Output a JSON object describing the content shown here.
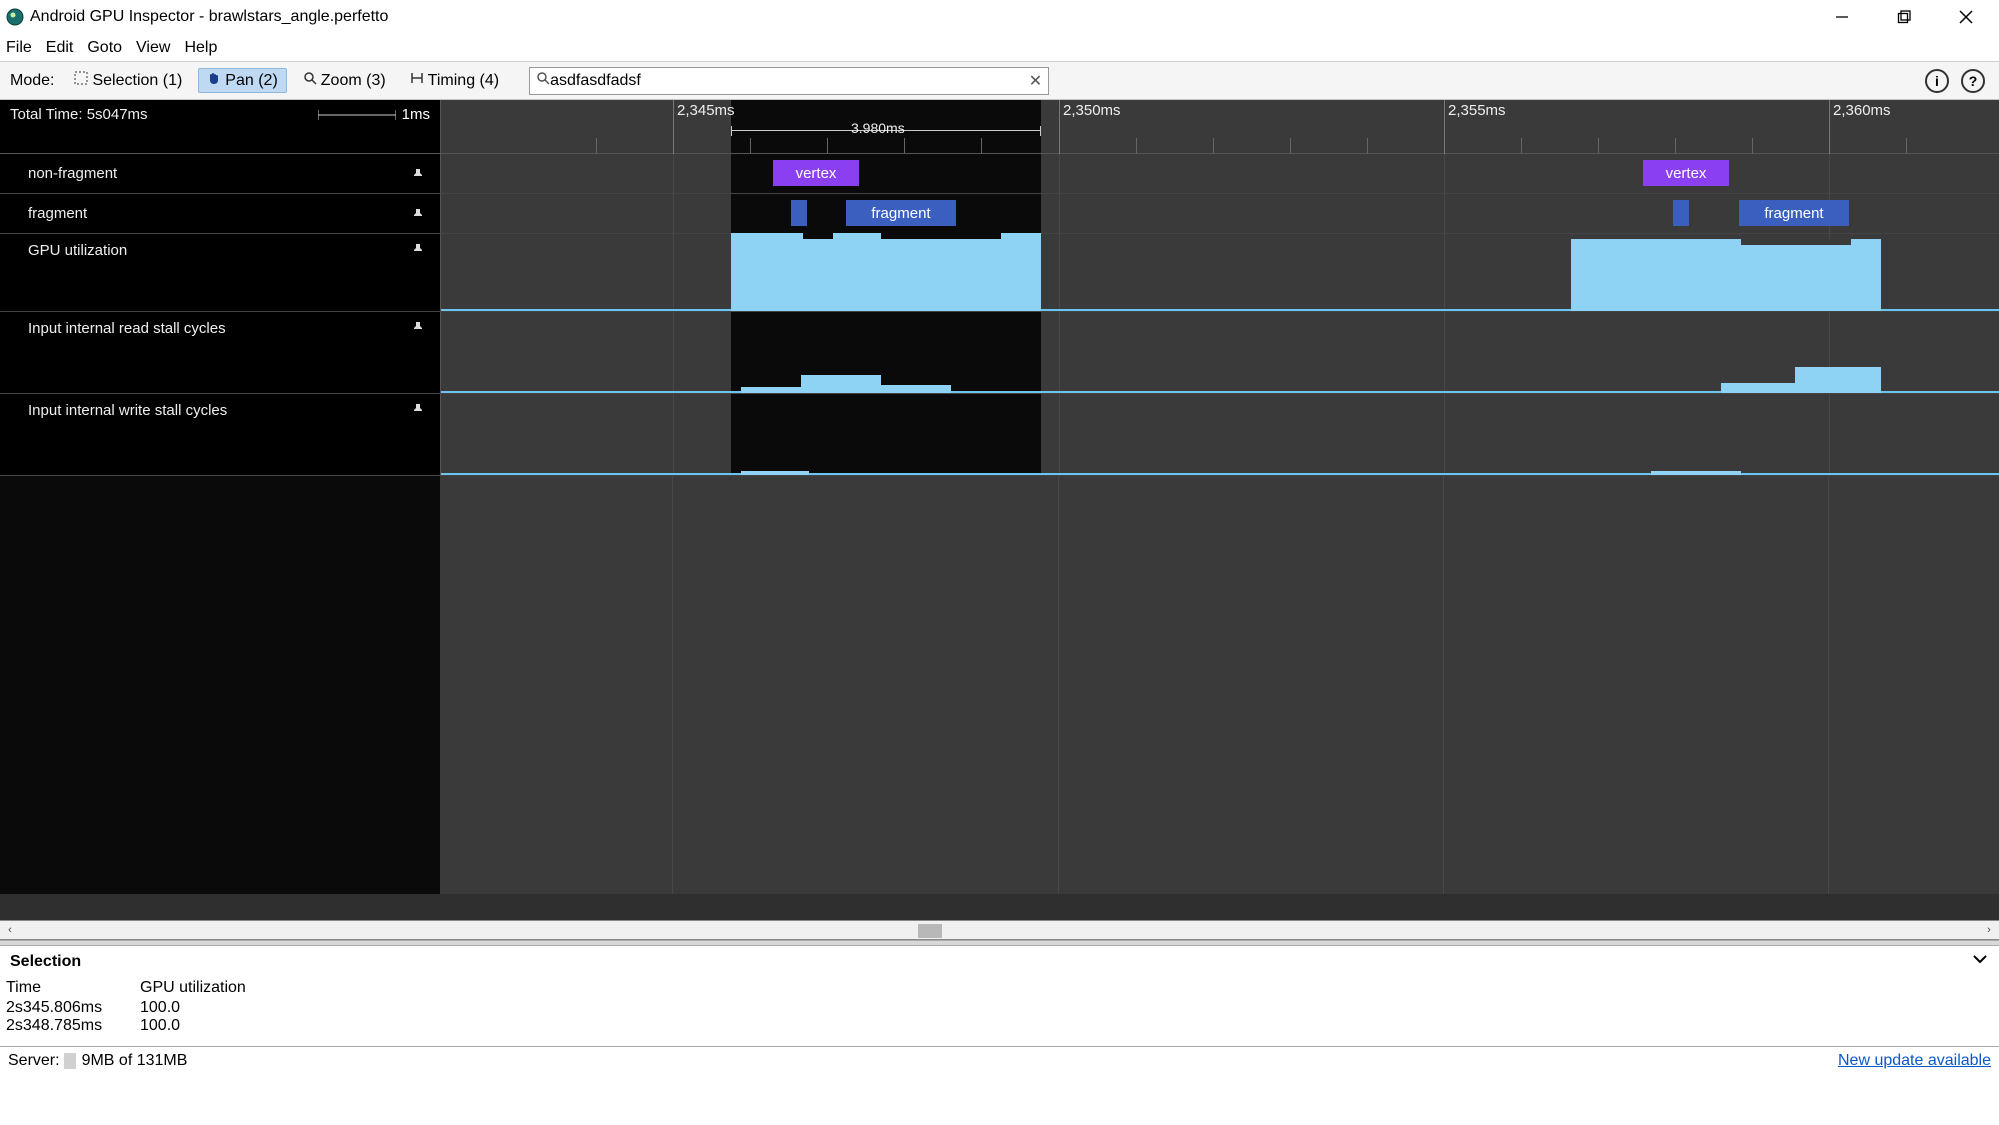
{
  "window": {
    "title": "Android GPU Inspector - brawlstars_angle.perfetto"
  },
  "menu": {
    "file": "File",
    "edit": "Edit",
    "goto": "Goto",
    "view": "View",
    "help": "Help"
  },
  "toolbar": {
    "mode_label": "Mode:",
    "selection": "Selection (1)",
    "pan": "Pan (2)",
    "zoom": "Zoom (3)",
    "timing": "Timing (4)",
    "search_value": "asdfasdfadsf"
  },
  "timeline": {
    "total_time": "Total Time: 5s047ms",
    "scale": "1ms",
    "span_duration": "3.980ms",
    "ticks": [
      "2,345ms",
      "2,350ms",
      "2,355ms",
      "2,360ms"
    ],
    "tracks": {
      "nonfragment": {
        "label": "non-fragment",
        "chip": "vertex"
      },
      "fragment": {
        "label": "fragment",
        "chip": "fragment"
      },
      "gpu_util": {
        "label": "GPU utilization"
      },
      "read_stall": {
        "label": "Input internal read stall cycles"
      },
      "write_stall": {
        "label": "Input internal write stall cycles"
      }
    }
  },
  "selection": {
    "title": "Selection",
    "col_time": "Time",
    "col_gpu": "GPU utilization",
    "rows": [
      {
        "time": "2s345.806ms",
        "gpu": "100.0"
      },
      {
        "time": "2s348.785ms",
        "gpu": "100.0"
      }
    ]
  },
  "status": {
    "server_label": "Server:",
    "server_mem": "9MB of 131MB",
    "update": "New update available"
  },
  "chart_data": {
    "type": "bar",
    "time_axis_ms": {
      "visible_start": 2342,
      "visible_end": 2363,
      "ticks_ms": [
        2345,
        2350,
        2355,
        2360
      ]
    },
    "selection_ms": {
      "start": 2345.3,
      "end": 2349.3,
      "duration_ms": 3.98
    },
    "tracks": [
      {
        "name": "non-fragment",
        "events": [
          {
            "label": "vertex",
            "start_ms": 2345.8,
            "end_ms": 2346.7
          },
          {
            "label": "vertex",
            "start_ms": 2357.0,
            "end_ms": 2358.0
          }
        ]
      },
      {
        "name": "fragment",
        "events": [
          {
            "label": "",
            "start_ms": 2345.9,
            "end_ms": 2346.1
          },
          {
            "label": "fragment",
            "start_ms": 2346.6,
            "end_ms": 2347.9
          },
          {
            "label": "",
            "start_ms": 2357.1,
            "end_ms": 2357.3
          },
          {
            "label": "fragment",
            "start_ms": 2357.9,
            "end_ms": 2359.2
          }
        ]
      },
      {
        "name": "GPU utilization",
        "unit": "percent",
        "samples": [
          {
            "start_ms": 2345.3,
            "end_ms": 2349.3,
            "value": 100
          },
          {
            "start_ms": 2355.8,
            "end_ms": 2359.8,
            "value": 100
          }
        ]
      },
      {
        "name": "Input internal read stall cycles",
        "samples": [
          {
            "start_ms": 2345.4,
            "end_ms": 2346.0,
            "value": 6
          },
          {
            "start_ms": 2346.0,
            "end_ms": 2346.9,
            "value": 18
          },
          {
            "start_ms": 2346.9,
            "end_ms": 2347.6,
            "value": 8
          },
          {
            "start_ms": 2357.4,
            "end_ms": 2358.2,
            "value": 10
          },
          {
            "start_ms": 2358.2,
            "end_ms": 2359.0,
            "value": 26
          }
        ]
      },
      {
        "name": "Input internal write stall cycles",
        "samples": [
          {
            "start_ms": 2345.4,
            "end_ms": 2346.1,
            "value": 4
          },
          {
            "start_ms": 2356.4,
            "end_ms": 2357.4,
            "value": 4
          }
        ]
      }
    ]
  }
}
